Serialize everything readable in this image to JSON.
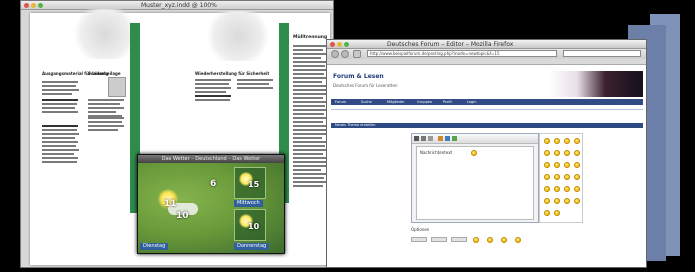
{
  "desktop": {
    "background": "#000000"
  },
  "document_window": {
    "title": "Muster_xyz.indd @ 100%",
    "accent_color": "#2f8d4c",
    "left_page_heading": "Ausgangsmaterial für Lösung",
    "left_page_heading_2": "Sonderbeilage",
    "right_page_heading": "Wiederherstellung für Sicherheit",
    "right_sidebar_heading": "Mülltrennung"
  },
  "weather_widget": {
    "title": "Das Wetter – Deutschland – Das Wetter",
    "temps": {
      "main": "11",
      "center_left": "10",
      "top": "6",
      "sub1": "15",
      "sub2": "10"
    },
    "days": {
      "today": "Dienstag",
      "sub1": "Mittwoch",
      "sub2": "Donnerstag"
    }
  },
  "browser": {
    "title": "Deutsches Forum – Editor – Mozilla Firefox",
    "url": "http://www.beispielforum.de/posting.php?mode=newtopic&f=15",
    "site_title": "Forum & Lesen",
    "site_subtitle": "Deutsches Forum für Leseratten",
    "nav_items": [
      "Forum",
      "Suche",
      "Mitglieder",
      "Gruppen",
      "Profil",
      "Login"
    ],
    "content_bar_label": "Neues Thema erstellen",
    "editor_label": "Nachrichtentext",
    "footer_label": "Optionen",
    "accent_color": "#2d4b82"
  }
}
